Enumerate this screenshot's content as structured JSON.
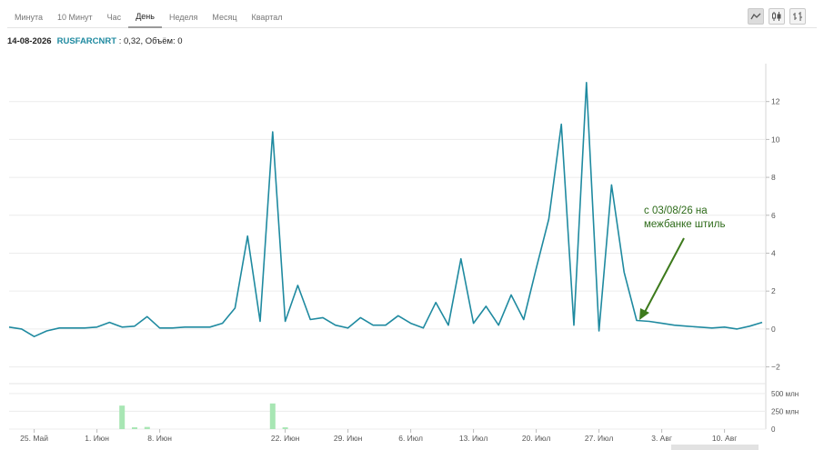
{
  "toolbar": {
    "tabs": [
      {
        "label": "Минута"
      },
      {
        "label": "10 Минут"
      },
      {
        "label": "Час"
      },
      {
        "label": "День",
        "active": true
      },
      {
        "label": "Неделя"
      },
      {
        "label": "Месяц"
      },
      {
        "label": "Квартал"
      }
    ],
    "tools": [
      "line-chart-icon",
      "candlestick-icon",
      "bar-chart-icon"
    ]
  },
  "info": {
    "date": "14-08-2026",
    "ticker": "RUSFARCNRT",
    "value_text": " : 0,32, Объём: 0"
  },
  "annotation": {
    "line1": "с 03/08/26 на",
    "line2": "межбанке штиль"
  },
  "colors": {
    "line": "#1f8aa0",
    "volume": "#a8e6b4",
    "arrow": "#3d7a1c",
    "grid": "#ececec"
  },
  "chart_data": {
    "type": "line",
    "x_tick_labels": [
      "25. Май",
      "1. Июн",
      "8. Июн",
      "22. Июн",
      "29. Июн",
      "6. Июл",
      "13. Июл",
      "20. Июл",
      "27. Июл",
      "3. Авг",
      "10. Авг"
    ],
    "x_tick_index": [
      2,
      7,
      12,
      22,
      27,
      32,
      37,
      42,
      47,
      52,
      57
    ],
    "price": {
      "ylim": [
        -2.5,
        14
      ],
      "y_ticks": [
        -2,
        0,
        2,
        4,
        6,
        8,
        10,
        12
      ],
      "y_tick_labels": [
        "−2",
        "0",
        "2",
        "4",
        "6",
        "8",
        "10",
        "12"
      ],
      "values": [
        0.1,
        0.0,
        -0.4,
        -0.1,
        0.05,
        0.05,
        0.05,
        0.1,
        0.35,
        0.1,
        0.15,
        0.65,
        0.05,
        0.05,
        0.1,
        0.1,
        0.1,
        0.3,
        1.1,
        4.9,
        0.4,
        10.4,
        0.4,
        2.3,
        0.5,
        0.6,
        0.2,
        0.05,
        0.6,
        0.2,
        0.2,
        0.7,
        0.3,
        0.05,
        1.4,
        0.2,
        3.7,
        0.3,
        1.2,
        0.2,
        1.8,
        0.5,
        3.2,
        5.8,
        10.8,
        0.2,
        13.0,
        -0.1,
        7.6,
        3.0,
        0.45,
        0.4,
        0.3,
        0.2,
        0.15,
        0.1,
        0.05,
        0.1,
        0.0,
        0.15,
        0.35
      ]
    },
    "volume": {
      "ylim": [
        0,
        600
      ],
      "y_ticks": [
        0,
        250,
        500
      ],
      "y_tick_labels": [
        "0",
        "250 млн",
        "500 млн"
      ],
      "values": [
        0,
        0,
        0,
        0,
        0,
        0,
        0,
        0,
        0,
        330,
        25,
        30,
        0,
        0,
        0,
        0,
        0,
        0,
        0,
        0,
        0,
        360,
        25,
        0,
        0,
        0,
        0,
        0,
        0,
        0,
        0,
        0,
        0,
        0,
        0,
        0,
        0,
        0,
        0,
        0,
        0,
        0,
        0,
        0,
        0,
        0,
        0,
        0,
        0,
        0,
        0,
        0,
        0,
        0,
        0,
        0,
        0,
        0,
        0,
        0,
        0
      ]
    }
  }
}
